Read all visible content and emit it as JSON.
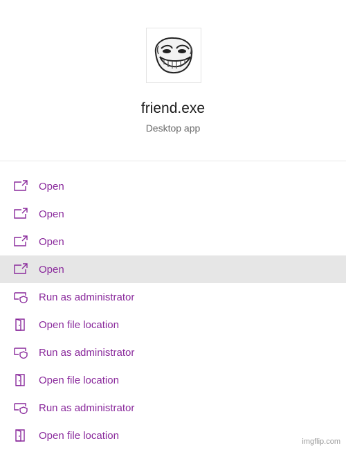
{
  "app": {
    "name": "friend.exe",
    "type": "Desktop app",
    "icon": "trollface-icon"
  },
  "menu": {
    "items": [
      {
        "label": "Open",
        "icon": "open-icon"
      },
      {
        "label": "Open",
        "icon": "open-icon"
      },
      {
        "label": "Open",
        "icon": "open-icon"
      },
      {
        "label": "Open",
        "icon": "open-icon",
        "highlighted": true
      },
      {
        "label": "Run as administrator",
        "icon": "shield-icon"
      },
      {
        "label": "Open file location",
        "icon": "folder-door-icon"
      },
      {
        "label": "Run as administrator",
        "icon": "shield-icon"
      },
      {
        "label": "Open file location",
        "icon": "folder-door-icon"
      },
      {
        "label": "Run as administrator",
        "icon": "shield-icon"
      },
      {
        "label": "Open file location",
        "icon": "folder-door-icon"
      }
    ]
  },
  "watermark": "imgflip.com",
  "colors": {
    "accent": "#8a2a9c",
    "highlight": "#e6e6e6"
  }
}
